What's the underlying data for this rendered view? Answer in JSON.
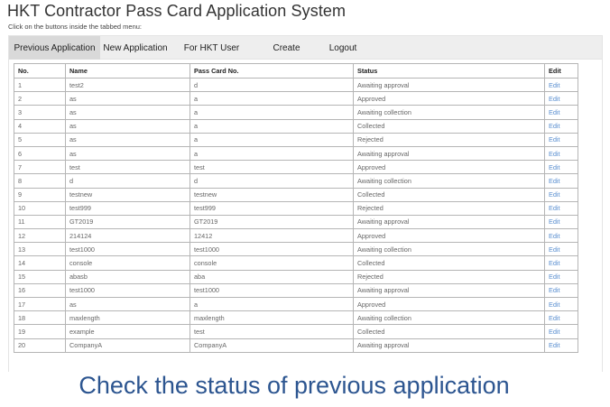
{
  "header": {
    "title": "HKT Contractor Pass Card Application System",
    "subtitle": "Click on the buttons inside the tabbed menu:"
  },
  "tabs": [
    {
      "label": "Previous Application",
      "active": true
    },
    {
      "label": "New Application",
      "active": false
    },
    {
      "label": "For HKT User Only",
      "active": false
    },
    {
      "label": "Create Account",
      "active": false
    },
    {
      "label": "Logout",
      "active": false
    }
  ],
  "table": {
    "columns": [
      "No.",
      "Name",
      "Pass Card No.",
      "Status",
      "Edit"
    ],
    "rows": [
      {
        "no": "1",
        "name": "test2",
        "card": "d",
        "status": "Awaiting approval",
        "edit": "Edit"
      },
      {
        "no": "2",
        "name": "as",
        "card": "a",
        "status": "Approved",
        "edit": "Edit"
      },
      {
        "no": "3",
        "name": "as",
        "card": "a",
        "status": "Awaiting collection",
        "edit": "Edit"
      },
      {
        "no": "4",
        "name": "as",
        "card": "a",
        "status": "Collected",
        "edit": "Edit"
      },
      {
        "no": "5",
        "name": "as",
        "card": "a",
        "status": "Rejected",
        "edit": "Edit"
      },
      {
        "no": "6",
        "name": "as",
        "card": "a",
        "status": "Awaiting approval",
        "edit": "Edit"
      },
      {
        "no": "7",
        "name": "test",
        "card": "test",
        "status": "Approved",
        "edit": "Edit"
      },
      {
        "no": "8",
        "name": "d",
        "card": "d",
        "status": "Awaiting collection",
        "edit": "Edit"
      },
      {
        "no": "9",
        "name": "testnew",
        "card": "testnew",
        "status": "Collected",
        "edit": "Edit"
      },
      {
        "no": "10",
        "name": "test999",
        "card": "test999",
        "status": "Rejected",
        "edit": "Edit"
      },
      {
        "no": "11",
        "name": "GT2019",
        "card": "GT2019",
        "status": "Awaiting approval",
        "edit": "Edit"
      },
      {
        "no": "12",
        "name": "214124",
        "card": "12412",
        "status": "Approved",
        "edit": "Edit"
      },
      {
        "no": "13",
        "name": "test1000",
        "card": "test1000",
        "status": "Awaiting collection",
        "edit": "Edit"
      },
      {
        "no": "14",
        "name": "console",
        "card": "console",
        "status": "Collected",
        "edit": "Edit"
      },
      {
        "no": "15",
        "name": "abasb",
        "card": "aba",
        "status": "Rejected",
        "edit": "Edit"
      },
      {
        "no": "16",
        "name": "test1000",
        "card": "test1000",
        "status": "Awaiting approval",
        "edit": "Edit"
      },
      {
        "no": "17",
        "name": "as",
        "card": "a",
        "status": "Approved",
        "edit": "Edit"
      },
      {
        "no": "18",
        "name": "maxlength",
        "card": "maxlength",
        "status": "Awaiting collection",
        "edit": "Edit"
      },
      {
        "no": "19",
        "name": "example",
        "card": "test",
        "status": "Collected",
        "edit": "Edit"
      },
      {
        "no": "20",
        "name": "CompanyA",
        "card": "CompanyA",
        "status": "Awaiting approval",
        "edit": "Edit"
      }
    ]
  },
  "caption": "Check the status of previous application",
  "colors": {
    "link": "#5a8fd0",
    "caption": "#2c5590",
    "tabbar_bg": "#eeeeee",
    "tab_active_bg": "#d9d9d9"
  }
}
